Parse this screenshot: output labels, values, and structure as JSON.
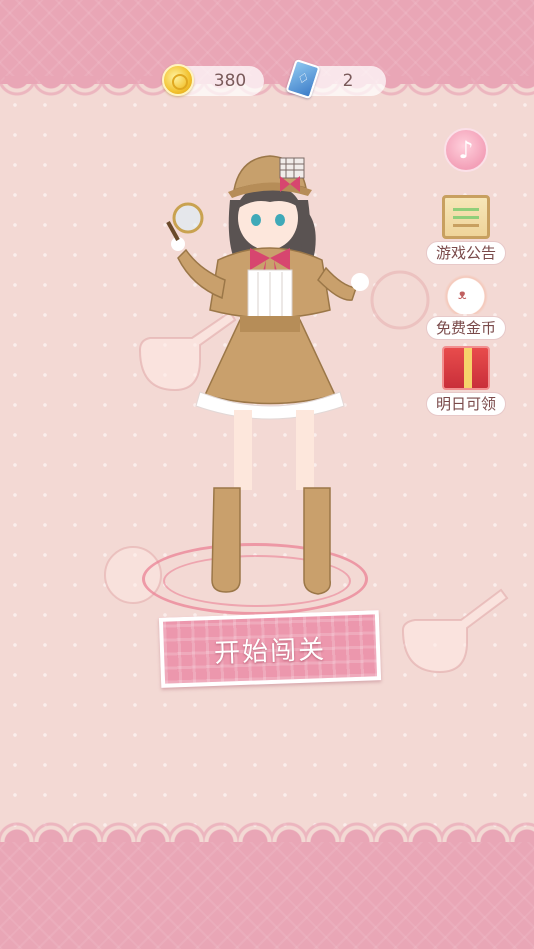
{
  "currency": {
    "coins_value": "380",
    "keys_value": "2"
  },
  "side_buttons": [
    {
      "label": "游戏公告",
      "icon": "notice-board-icon"
    },
    {
      "label": "免费金币",
      "icon": "lucky-cat-icon"
    },
    {
      "label": "明日可领",
      "icon": "gift-box-icon"
    }
  ],
  "music_icon": "music-note-icon",
  "start_button": {
    "label": "开始闯关"
  },
  "colors": {
    "background": "#f3d9d4",
    "band_pink": "#e9a6b6",
    "button_pink": "#ec97ad",
    "label_text": "#7a4a4a"
  }
}
